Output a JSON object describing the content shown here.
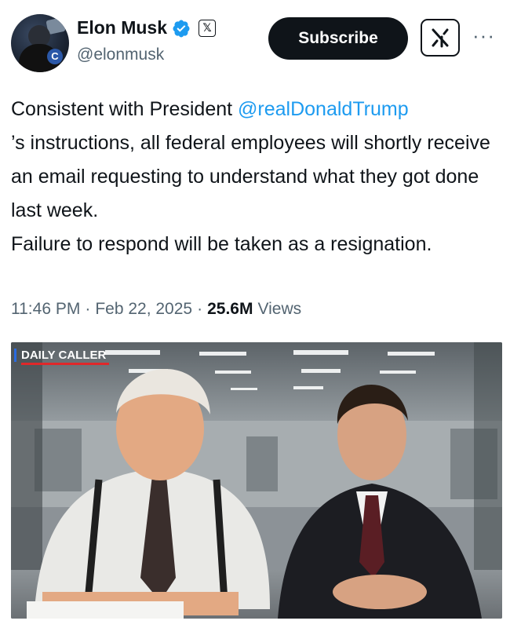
{
  "author": {
    "display_name": "Elon Musk",
    "handle": "@elonmusk",
    "verified_icon": "verified-badge-icon",
    "affiliation_icon": "x-logo-icon"
  },
  "actions": {
    "subscribe_label": "Subscribe",
    "grok_icon": "grok-icon",
    "more_icon": "more-options-icon"
  },
  "tweet": {
    "text_before_mention": "Consistent with President ",
    "mention": "@realDonaldTrump",
    "text_after_mention": "’s instructions, all federal employees will shortly receive an email requesting to understand what they got done last week.",
    "text_second": "Failure to respond will be taken as a resignation."
  },
  "meta": {
    "time": "11:46 PM",
    "date": "Feb 22, 2025",
    "separator": "·",
    "views_count": "25.6M",
    "views_label": "Views"
  },
  "media": {
    "watermark": "DAILY CALLER"
  },
  "colors": {
    "accent": "#1d9bf0",
    "text": "#0f1419",
    "muted": "#536471"
  }
}
